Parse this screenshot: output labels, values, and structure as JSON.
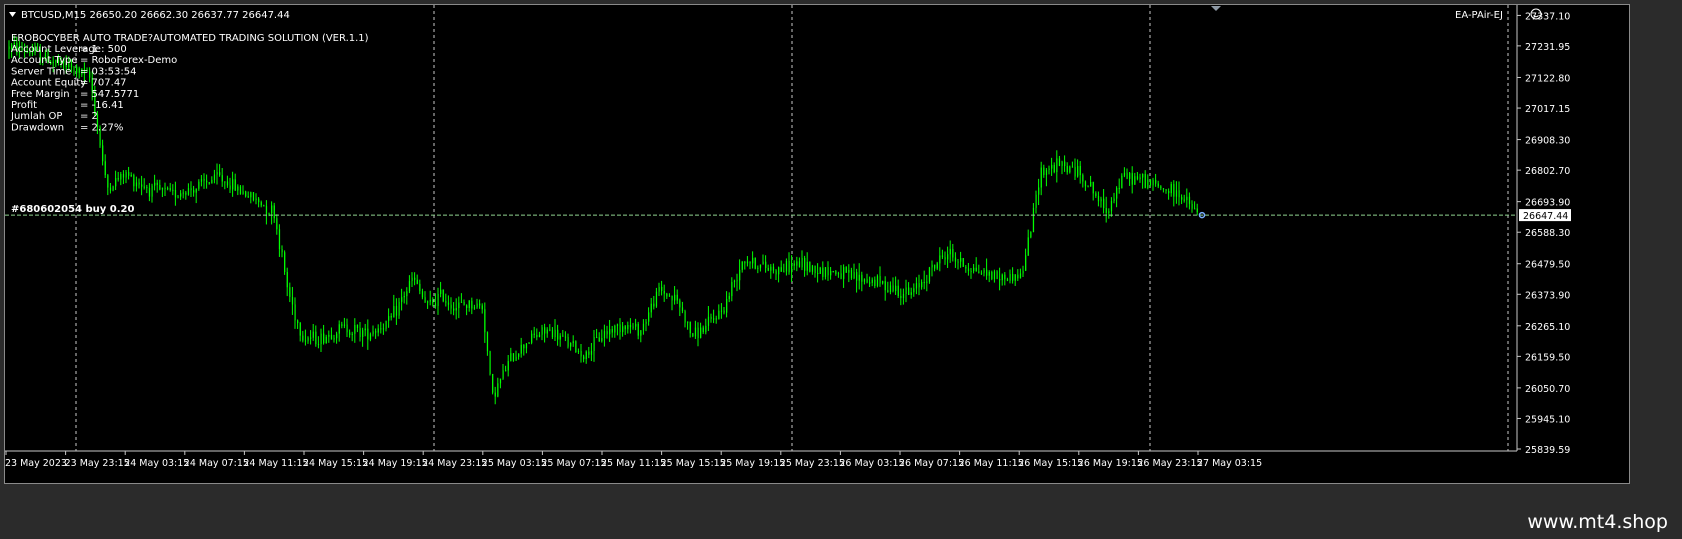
{
  "header": {
    "symbol_line": "BTCUSD,M15  26650.20 26662.30 26637.77 26647.44",
    "ea_label": "EA-PAir-EJ"
  },
  "info_panel": {
    "title": "EROBOCYBER AUTO TRADE?AUTOMATED TRADING SOLUTION (VER.1.1)",
    "rows": [
      {
        "label": "Account Leverage",
        "value": "=  1 : 500"
      },
      {
        "label": "Account Type",
        "value": "=  RoboForex-Demo"
      },
      {
        "label": "Server Time",
        "value": "=  03:53:54"
      },
      {
        "label": "Account Equity",
        "value": "=  707.47"
      },
      {
        "label": "Free Margin",
        "value": "=  547.5771"
      },
      {
        "label": "Profit",
        "value": "=  -16.41"
      },
      {
        "label": "Jumlah OP",
        "value": "=  2"
      },
      {
        "label": "Drawdown",
        "value": "=  2.27%"
      }
    ]
  },
  "order_line": {
    "label": "#680602054 buy 0.20",
    "price": 26647.44,
    "price_label": "26647.44"
  },
  "watermark": "www.mt4.shop",
  "colors": {
    "background": "#000000",
    "candle": "#00ff00",
    "grid": "#c8c8c8",
    "order_line": "#8fd38f",
    "text": "#ffffff"
  },
  "chart_data": {
    "type": "candlestick",
    "symbol": "BTCUSD",
    "timeframe": "M15",
    "ylim": [
      25839.59,
      27380
    ],
    "y_ticks": [
      "27337.10",
      "27231.95",
      "27122.80",
      "27017.15",
      "26908.30",
      "26802.70",
      "26693.90",
      "26588.30",
      "26479.50",
      "26373.90",
      "26265.10",
      "26159.50",
      "26050.70",
      "25945.10",
      "25839.59"
    ],
    "x_ticks": [
      "23 May 2023",
      "23 May 23:15",
      "24 May 03:15",
      "24 May 07:15",
      "24 May 11:15",
      "24 May 15:15",
      "24 May 19:15",
      "24 May 23:15",
      "25 May 03:15",
      "25 May 07:15",
      "25 May 11:15",
      "25 May 15:15",
      "25 May 19:15",
      "25 May 23:15",
      "26 May 03:15",
      "26 May 07:15",
      "26 May 11:15",
      "26 May 15:15",
      "26 May 19:15",
      "26 May 23:15",
      "27 May 03:15"
    ],
    "grid": "vertical dashed",
    "close_path": [
      {
        "t": 0,
        "y": 27230
      },
      {
        "t": 0.05,
        "y": 27210
      },
      {
        "t": 0.09,
        "y": 27180
      },
      {
        "t": 0.13,
        "y": 27160
      },
      {
        "t": 0.175,
        "y": 27120
      },
      {
        "t": 0.21,
        "y": 26740
      },
      {
        "t": 0.25,
        "y": 26790
      },
      {
        "t": 0.3,
        "y": 26740
      },
      {
        "t": 0.35,
        "y": 26720
      },
      {
        "t": 0.4,
        "y": 26740
      },
      {
        "t": 0.45,
        "y": 26780
      },
      {
        "t": 0.49,
        "y": 26740
      },
      {
        "t": 0.53,
        "y": 26700
      },
      {
        "t": 0.57,
        "y": 26660
      },
      {
        "t": 0.6,
        "y": 26390
      },
      {
        "t": 0.63,
        "y": 26230
      },
      {
        "t": 0.67,
        "y": 26220
      },
      {
        "t": 0.72,
        "y": 26260
      },
      {
        "t": 0.77,
        "y": 26240
      },
      {
        "t": 0.82,
        "y": 26280
      },
      {
        "t": 0.87,
        "y": 26430
      },
      {
        "t": 0.9,
        "y": 26330
      },
      {
        "t": 0.93,
        "y": 26370
      },
      {
        "t": 0.96,
        "y": 26330
      },
      {
        "t": 0.99,
        "y": 26340
      },
      {
        "t": 1.02,
        "y": 26330
      },
      {
        "t": 1.04,
        "y": 26020
      },
      {
        "t": 1.08,
        "y": 26150
      },
      {
        "t": 1.12,
        "y": 26220
      },
      {
        "t": 1.16,
        "y": 26250
      },
      {
        "t": 1.2,
        "y": 26210
      },
      {
        "t": 1.24,
        "y": 26160
      },
      {
        "t": 1.28,
        "y": 26240
      },
      {
        "t": 1.32,
        "y": 26270
      },
      {
        "t": 1.36,
        "y": 26250
      },
      {
        "t": 1.4,
        "y": 26390
      },
      {
        "t": 1.44,
        "y": 26350
      },
      {
        "t": 1.47,
        "y": 26230
      },
      {
        "t": 1.5,
        "y": 26260
      },
      {
        "t": 1.54,
        "y": 26330
      },
      {
        "t": 1.58,
        "y": 26500
      },
      {
        "t": 1.62,
        "y": 26470
      },
      {
        "t": 1.66,
        "y": 26460
      },
      {
        "t": 1.7,
        "y": 26480
      },
      {
        "t": 1.74,
        "y": 26460
      },
      {
        "t": 1.78,
        "y": 26450
      },
      {
        "t": 1.82,
        "y": 26430
      },
      {
        "t": 1.86,
        "y": 26420
      },
      {
        "t": 1.9,
        "y": 26400
      },
      {
        "t": 1.94,
        "y": 26370
      },
      {
        "t": 1.98,
        "y": 26450
      },
      {
        "t": 2.02,
        "y": 26520
      },
      {
        "t": 2.06,
        "y": 26470
      },
      {
        "t": 2.1,
        "y": 26450
      },
      {
        "t": 2.14,
        "y": 26430
      },
      {
        "t": 2.18,
        "y": 26440
      },
      {
        "t": 2.2,
        "y": 26600
      },
      {
        "t": 2.22,
        "y": 26800
      },
      {
        "t": 2.26,
        "y": 26820
      },
      {
        "t": 2.3,
        "y": 26800
      },
      {
        "t": 2.33,
        "y": 26740
      },
      {
        "t": 2.36,
        "y": 26660
      },
      {
        "t": 2.4,
        "y": 26780
      },
      {
        "t": 2.44,
        "y": 26770
      },
      {
        "t": 2.48,
        "y": 26740
      },
      {
        "t": 2.52,
        "y": 26720
      },
      {
        "t": 2.56,
        "y": 26647
      }
    ]
  }
}
